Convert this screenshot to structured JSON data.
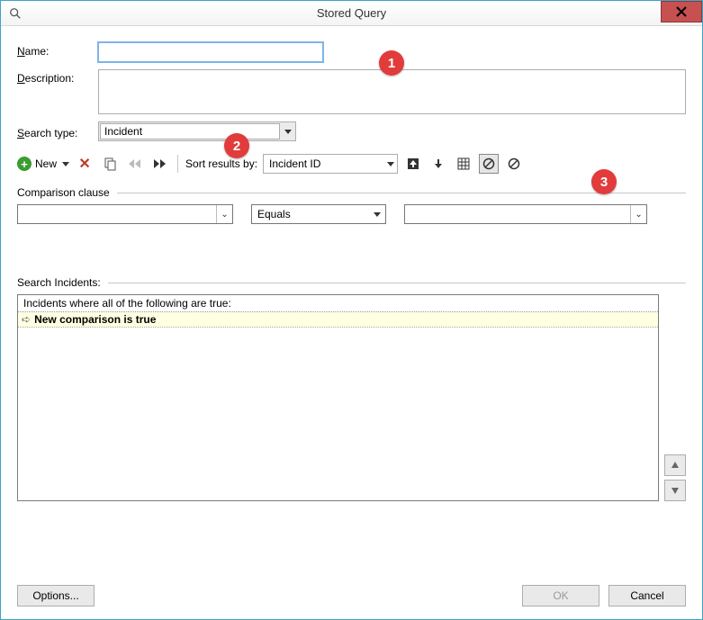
{
  "window": {
    "title": "Stored Query"
  },
  "labels": {
    "name": "Name:",
    "description": "Description:",
    "search_type": "Search type:",
    "sort_by": "Sort results by:",
    "comparison_clause": "Comparison clause",
    "search_incidents": "Search Incidents:"
  },
  "fields": {
    "name_value": "",
    "description_value": "",
    "search_type_value": "Incident",
    "sort_by_value": "Incident ID"
  },
  "toolbar": {
    "new_label": "New"
  },
  "clause": {
    "field_value": "",
    "operator_value": "Equals",
    "value_value": ""
  },
  "results": {
    "header_text": "Incidents where all of the following are true:",
    "row1_text": "New comparison is true"
  },
  "footer": {
    "options_label": "Options...",
    "ok_label": "OK",
    "cancel_label": "Cancel"
  },
  "callouts": {
    "c1": "1",
    "c2": "2",
    "c3": "3"
  }
}
